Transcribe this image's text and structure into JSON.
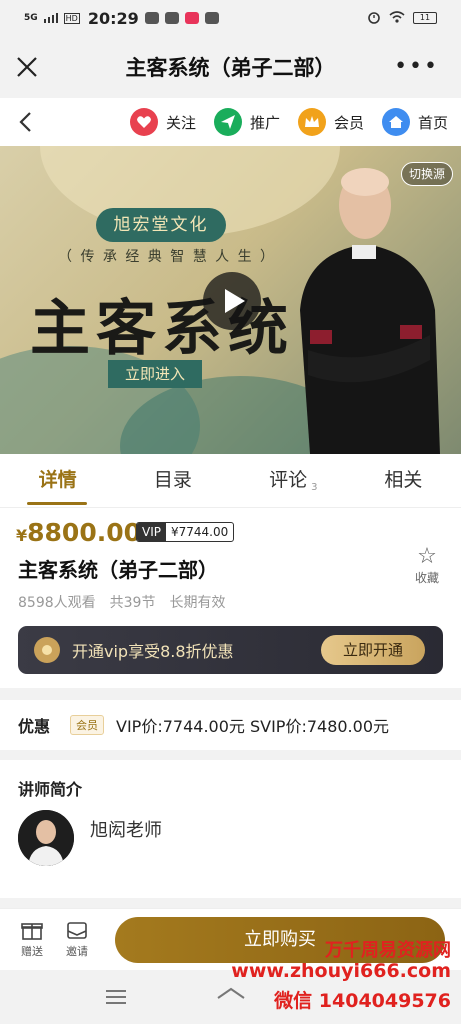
{
  "status_bar": {
    "network": "5G",
    "time": "20:29",
    "battery": "11"
  },
  "titlebar": {
    "title": "主客系统（弟子二部）"
  },
  "nav": {
    "items": [
      {
        "label": "关注",
        "color": "#e8414f"
      },
      {
        "label": "推广",
        "color": "#1aad5b"
      },
      {
        "label": "会员",
        "color": "#f1a21b"
      },
      {
        "label": "首页",
        "color": "#3f8df0"
      }
    ]
  },
  "video": {
    "brand": "旭宏堂文化",
    "slogan": "（ 传 承 经 典   智 慧 人 生 ）",
    "headline": "主客系统",
    "enter": "立即进入",
    "switch_source": "切换源"
  },
  "tabs": [
    {
      "label": "详情"
    },
    {
      "label": "目录"
    },
    {
      "label": "评论",
      "badge": "3"
    },
    {
      "label": "相关"
    }
  ],
  "product": {
    "currency": "¥",
    "price": "8800.00",
    "vip_tag": "VIP",
    "vip_price": "¥7744.00",
    "title": "主客系统（弟子二部）",
    "views": "8598人观看",
    "lessons": "共39节",
    "validity": "长期有效",
    "favorite": "收藏",
    "vip_banner": "开通vip享受8.8折优惠",
    "vip_button": "立即开通"
  },
  "discount": {
    "label": "优惠",
    "member_tag": "会员",
    "text": "VIP价:7744.00元   SVIP价:7480.00元"
  },
  "lecturer": {
    "heading": "讲师简介",
    "name": "旭闳老师"
  },
  "bottom": {
    "gift": "赠送",
    "invite": "邀请",
    "buy": "立即购买"
  },
  "watermark": {
    "line1": "万千周易资源网",
    "line2": "www.zhouyi666.com",
    "line3": "微信 1404049576"
  }
}
